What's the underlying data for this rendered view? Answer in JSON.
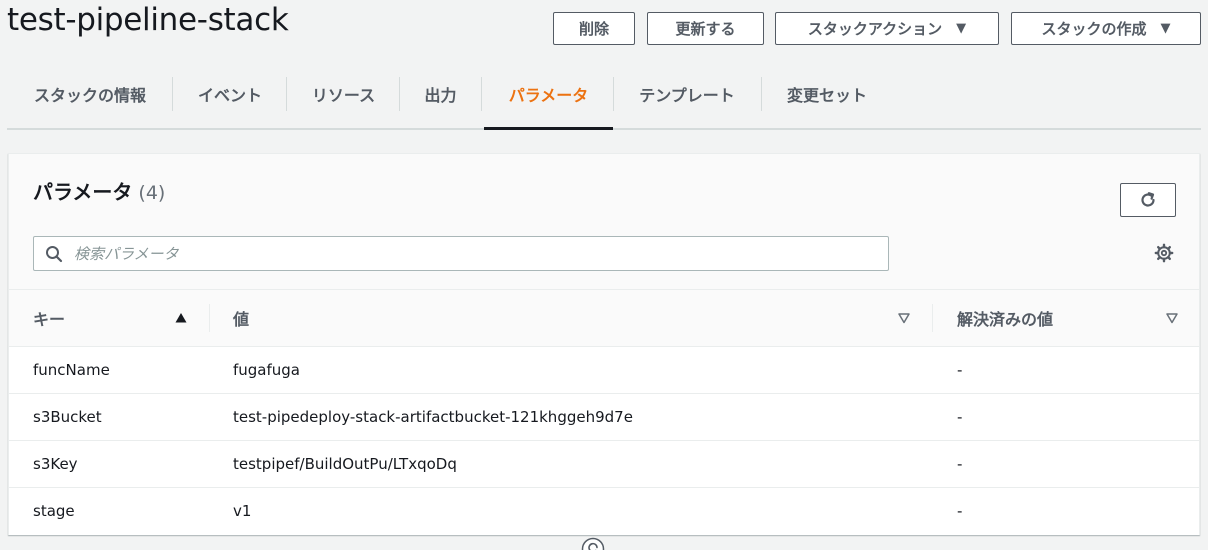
{
  "header": {
    "title": "test-pipeline-stack",
    "buttons": {
      "delete": "削除",
      "update": "更新する",
      "stack_actions": "スタックアクション",
      "create_stack": "スタックの作成"
    }
  },
  "tabs": [
    {
      "label": "スタックの情報"
    },
    {
      "label": "イベント"
    },
    {
      "label": "リソース"
    },
    {
      "label": "出力"
    },
    {
      "label": "パラメータ",
      "active": true
    },
    {
      "label": "テンプレート"
    },
    {
      "label": "変更セット"
    }
  ],
  "panel": {
    "title": "パラメータ",
    "count": "(4)",
    "search_placeholder": "検索パラメータ",
    "columns": {
      "key": "キー",
      "value": "値",
      "resolved": "解決済みの値"
    },
    "rows": [
      {
        "key": "funcName",
        "value": "fugafuga",
        "resolved": "-"
      },
      {
        "key": "s3Bucket",
        "value": "test-pipedeploy-stack-artifactbucket-121khggeh9d7e",
        "resolved": "-"
      },
      {
        "key": "s3Key",
        "value": "testpipef/BuildOutPu/LTxqoDq",
        "resolved": "-"
      },
      {
        "key": "stage",
        "value": "v1",
        "resolved": "-"
      }
    ]
  },
  "colors": {
    "accent": "#ec7211",
    "text": "#16191f",
    "muted": "#545b64",
    "background": "#f2f3f3"
  }
}
